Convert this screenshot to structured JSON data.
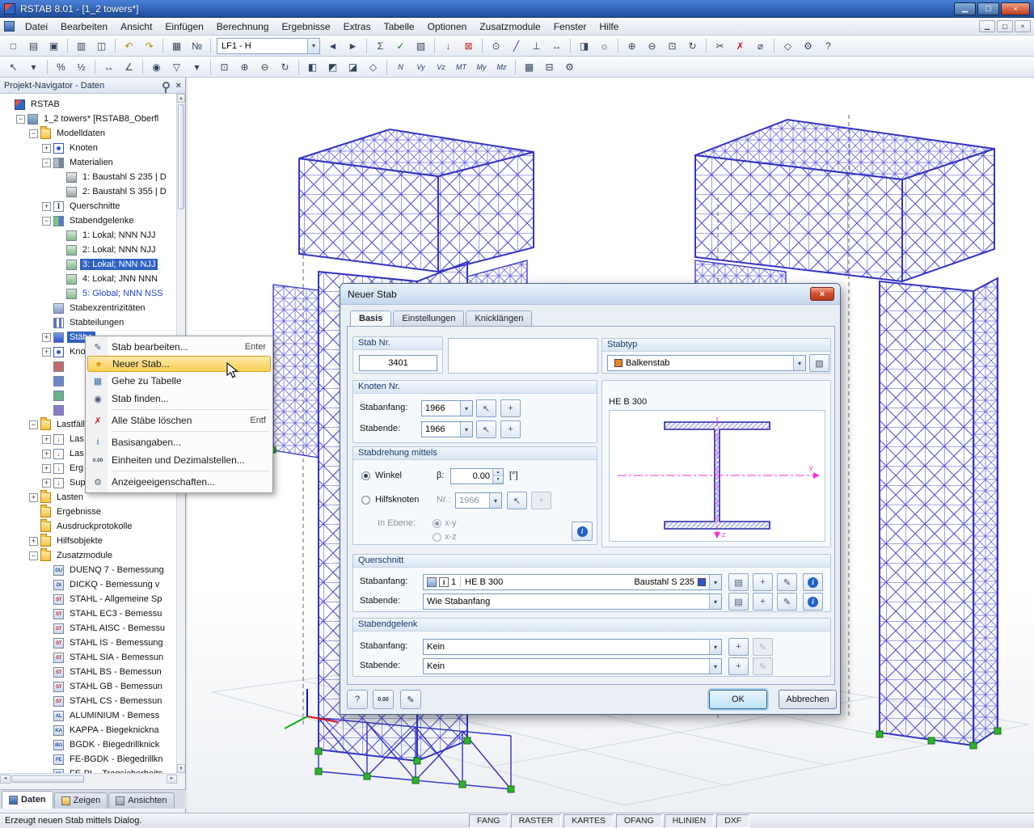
{
  "colors": {
    "titlebar1": "#4a7fd6",
    "titlebar2": "#1f4f9e",
    "selection": "#2f62c2",
    "menu-highlight1": "#fdeaa9",
    "menu-highlight2": "#f8cf57",
    "menu-highlight-border": "#d8a020",
    "model-blue": "#3c3ccd",
    "support-green": "#2db32d",
    "section-line": "#2626a8",
    "centerline-magenta": "#f230d8"
  },
  "titlebar": {
    "title": "RSTAB 8.01 - [1_2 towers*]",
    "minimize_glyph": "▁",
    "restore_glyph": "▢",
    "close_glyph": "×"
  },
  "menubar": {
    "items": [
      "Datei",
      "Bearbeiten",
      "Ansicht",
      "Einfügen",
      "Berechnung",
      "Ergebnisse",
      "Extras",
      "Tabelle",
      "Optionen",
      "Zusatzmodule",
      "Fenster",
      "Hilfe"
    ]
  },
  "toolbars": {
    "load_case": "LF1 - H",
    "row1": [
      {
        "g": "□",
        "n": "new-model"
      },
      {
        "g": "▤",
        "n": "open-model"
      },
      {
        "g": "▣",
        "n": "save-model"
      },
      "sep",
      {
        "g": "▥",
        "n": "print"
      },
      {
        "g": "◫",
        "n": "copy"
      },
      "sep",
      {
        "g": "↶",
        "n": "undo",
        "c": "#b08900"
      },
      {
        "g": "↷",
        "n": "redo",
        "c": "#b08900"
      },
      "sep",
      {
        "g": "▦",
        "n": "tables"
      },
      {
        "g": "№",
        "n": "numbering"
      },
      "sep",
      "combo",
      {
        "g": "◄",
        "n": "previous-load-case"
      },
      {
        "g": "►",
        "n": "next-load-case"
      },
      "sep",
      {
        "g": "Σ",
        "n": "calculate"
      },
      {
        "g": "✓",
        "n": "check-model",
        "c": "#118811"
      },
      {
        "g": "▧",
        "n": "show-results"
      },
      "sep",
      {
        "g": "↓",
        "n": "new-load",
        "c": "#bb2222"
      },
      {
        "g": "⊠",
        "n": "delete-load",
        "c": "#bb2222"
      },
      "sep",
      {
        "g": "⊙",
        "n": "new-node"
      },
      {
        "g": "╱",
        "n": "new-member",
        "c": "#2233bb"
      },
      {
        "g": "⊥",
        "n": "new-support"
      },
      {
        "g": "↔",
        "n": "new-dimension"
      },
      "sep",
      {
        "g": "◨",
        "n": "render-mode"
      },
      {
        "g": "☼",
        "n": "lighting"
      },
      "sep",
      {
        "g": "⊕",
        "n": "zoom-in"
      },
      {
        "g": "⊖",
        "n": "zoom-out"
      },
      {
        "g": "⊡",
        "n": "zoom-window"
      },
      {
        "g": "↻",
        "n": "rotate-view"
      },
      "sep",
      {
        "g": "✂",
        "n": "clip"
      },
      {
        "g": "✗",
        "n": "delete",
        "c": "#bb2222"
      },
      {
        "g": "⌀",
        "n": "measure"
      },
      "sep",
      {
        "g": "◇",
        "n": "isometric-view"
      },
      {
        "g": "⚙",
        "n": "options"
      },
      {
        "g": "?",
        "n": "help"
      }
    ],
    "row2": [
      {
        "g": "↖",
        "n": "select-pointer"
      },
      {
        "g": "▾",
        "n": "select-mode-dropdown"
      },
      "sep",
      {
        "g": "%",
        "n": "percentage"
      },
      {
        "g": "½",
        "n": "scale-half"
      },
      "sep",
      {
        "g": "↔",
        "n": "measure-length"
      },
      {
        "g": "∠",
        "n": "measure-angle"
      },
      "sep",
      {
        "g": "◉",
        "n": "visibility"
      },
      {
        "g": "▽",
        "n": "filter"
      },
      {
        "g": "▾",
        "n": "visibility-dropdown"
      },
      "sep",
      {
        "g": "⊡",
        "n": "zoom-region"
      },
      {
        "g": "⊕",
        "n": "view-zoom-in"
      },
      {
        "g": "⊖",
        "n": "view-zoom-out"
      },
      {
        "g": "↻",
        "n": "orbit"
      },
      "sep",
      {
        "g": "◧",
        "n": "view-yz"
      },
      {
        "g": "◩",
        "n": "view-xz"
      },
      {
        "g": "◪",
        "n": "view-xy"
      },
      {
        "g": "◇",
        "n": "view-iso"
      },
      "sep",
      {
        "s": "N",
        "n": "result-n"
      },
      {
        "s": "Vy",
        "n": "result-vy"
      },
      {
        "s": "Vz",
        "n": "result-vz"
      },
      {
        "s": "MT",
        "n": "result-mt"
      },
      {
        "s": "My",
        "n": "result-my"
      },
      {
        "s": "Mz",
        "n": "result-mz"
      },
      "sep",
      {
        "g": "▦",
        "n": "result-tables"
      },
      {
        "g": "⊟",
        "n": "panel-toggle"
      },
      {
        "g": "⚙",
        "n": "display-options"
      }
    ]
  },
  "navigator": {
    "title": "Projekt-Navigator - Daten",
    "tabs": [
      {
        "label": "Daten",
        "active": true
      },
      {
        "label": "Zeigen"
      },
      {
        "label": "Ansichten"
      }
    ],
    "tree": [
      {
        "l": "RSTAB",
        "v": 0,
        "i": "app"
      },
      {
        "l": "1_2 towers* [RSTAB8_Oberfl",
        "v": 1,
        "i": "building",
        "e": "-"
      },
      {
        "l": "Modelldaten",
        "v": 2,
        "i": "folder",
        "e": "-"
      },
      {
        "l": "Knoten",
        "v": 3,
        "i": "knoten",
        "e": "+"
      },
      {
        "l": "Materialien",
        "v": 3,
        "i": "material",
        "e": "-"
      },
      {
        "l": "1: Baustahl S 235 | D",
        "v": 4,
        "i": "matitem"
      },
      {
        "l": "2: Baustahl S 355 | D",
        "v": 4,
        "i": "matitem"
      },
      {
        "l": "Querschnitte",
        "v": 3,
        "i": "section",
        "e": "+"
      },
      {
        "l": "Stabendgelenke",
        "v": 3,
        "i": "hinge",
        "e": "-"
      },
      {
        "l": "1: Lokal; NNN NJJ",
        "v": 4,
        "i": "hingeitem"
      },
      {
        "l": "2: Lokal; NNN NJJ",
        "v": 4,
        "i": "hingeitem"
      },
      {
        "l": "3: Lokal; NNN NJJ",
        "v": 4,
        "i": "hingeitem",
        "sel": true
      },
      {
        "l": "4: Lokal; JNN NNN",
        "v": 4,
        "i": "hingeitem"
      },
      {
        "l": "5: Global; NNN NSS",
        "v": 4,
        "i": "hingeitem",
        "link": true
      },
      {
        "l": "Stabexzentrizitäten",
        "v": 3,
        "i": "exz"
      },
      {
        "l": "Stabteilungen",
        "v": 3,
        "i": "teilung"
      },
      {
        "l": "Stäbe",
        "v": 3,
        "i": "stab",
        "e": "+",
        "sel": true
      },
      {
        "l": "Kno",
        "v": 3,
        "i": "knoten",
        "e": "+"
      },
      {
        "l": "",
        "v": 3,
        "i": "stab",
        "tint": "#c86a6a"
      },
      {
        "l": "",
        "v": 3,
        "i": "stab",
        "tint": "#6a88c8"
      },
      {
        "l": "",
        "v": 3,
        "i": "stab",
        "tint": "#6ab08a"
      },
      {
        "l": "",
        "v": 3,
        "i": "stab",
        "tint": "#8a7ac8"
      },
      {
        "l": "Lastfäll",
        "v": 2,
        "i": "folder",
        "e": "-"
      },
      {
        "l": "Las",
        "v": 3,
        "i": "lf",
        "e": "+"
      },
      {
        "l": "Las",
        "v": 3,
        "i": "lf",
        "e": "+"
      },
      {
        "l": "Erg",
        "v": 3,
        "i": "lf",
        "e": "+"
      },
      {
        "l": "Sup",
        "v": 3,
        "i": "lf",
        "e": "+"
      },
      {
        "l": "Lasten",
        "v": 2,
        "i": "folder",
        "e": "+"
      },
      {
        "l": "Ergebnisse",
        "v": 2,
        "i": "folder"
      },
      {
        "l": "Ausdruckprotokolle",
        "v": 2,
        "i": "folder"
      },
      {
        "l": "Hilfsobjekte",
        "v": 2,
        "i": "folder",
        "e": "+"
      },
      {
        "l": "Zusatzmodule",
        "v": 2,
        "i": "folder",
        "e": "-"
      },
      {
        "l": "DUENQ 7 - Bemessung",
        "v": 3,
        "i": "mod"
      },
      {
        "l": "DICKQ - Bemessung v",
        "v": 3,
        "i": "mod"
      },
      {
        "l": "STAHL - Allgemeine Sp",
        "v": 3,
        "i": "mod"
      },
      {
        "l": "STAHL EC3 - Bemessu",
        "v": 3,
        "i": "mod"
      },
      {
        "l": "STAHL AISC - Bemessu",
        "v": 3,
        "i": "mod"
      },
      {
        "l": "STAHL IS - Bemessung",
        "v": 3,
        "i": "mod"
      },
      {
        "l": "STAHL SIA - Bemessun",
        "v": 3,
        "i": "mod"
      },
      {
        "l": "STAHL BS - Bemessun",
        "v": 3,
        "i": "mod"
      },
      {
        "l": "STAHL GB - Bemessun",
        "v": 3,
        "i": "mod"
      },
      {
        "l": "STAHL CS - Bemessun",
        "v": 3,
        "i": "mod"
      },
      {
        "l": "ALUMINIUM - Bemess",
        "v": 3,
        "i": "mod"
      },
      {
        "l": "KAPPA - Biegeknickna",
        "v": 3,
        "i": "mod"
      },
      {
        "l": "BGDK - Biegedrillknick",
        "v": 3,
        "i": "mod"
      },
      {
        "l": "FE-BGDK - Biegedrillkn",
        "v": 3,
        "i": "mod"
      },
      {
        "l": "FE-PL - Tragsicherheits",
        "v": 3,
        "i": "mod"
      }
    ]
  },
  "context_menu": {
    "items": [
      {
        "label": "Stab bearbeiten...",
        "shortcut": "Enter",
        "icon": "edit-member-icon",
        "g": "✎",
        "gc": "#44557a"
      },
      {
        "label": "Neuer Stab...",
        "icon": "new-member-icon",
        "g": "★",
        "gc": "#e09b00",
        "highlighted": true
      },
      {
        "label": "Gehe zu Tabelle",
        "icon": "table-icon",
        "g": "▦",
        "gc": "#3a6ea5"
      },
      {
        "label": "Stab finden...",
        "icon": "find-member-icon",
        "g": "◉",
        "gc": "#44557a",
        "separator_after": true
      },
      {
        "label": "Alle Stäbe löschen",
        "shortcut": "Entf",
        "icon": "delete-all-icon",
        "g": "✗",
        "gc": "#cc2222",
        "separator_after": true
      },
      {
        "label": "Basisangaben...",
        "icon": "base-data-icon",
        "g": "i",
        "gc": "#2266cc"
      },
      {
        "label": "Einheiten und Dezimalstellen...",
        "icon": "units-icon",
        "g": "0.00",
        "gc": "#334455",
        "small": true,
        "separator_after": true
      },
      {
        "label": "Anzeigeeigenschaften...",
        "icon": "display-properties-icon",
        "g": "⚙",
        "gc": "#556677"
      }
    ]
  },
  "dialog": {
    "title": "Neuer Stab",
    "tabs": [
      "Basis",
      "Einstellungen",
      "Knicklängen"
    ],
    "stab_nr": {
      "caption": "Stab Nr.",
      "value": "3401"
    },
    "stabtyp": {
      "caption": "Stabtyp",
      "value": "Balkenstab"
    },
    "knoten": {
      "caption": "Knoten Nr.",
      "anfang_label": "Stabanfang:",
      "anfang": "1966",
      "ende_label": "Stabende:",
      "ende": "1966"
    },
    "drehung": {
      "caption": "Stabdrehung mittels",
      "winkel": "Winkel",
      "beta": "β:",
      "beta_value": "0.00",
      "unit": "[°]",
      "hilfsknoten": "Hilfsknoten",
      "nr": "Nr.:",
      "nr_value": "1966",
      "ebene": "In Ebene:",
      "xy": "x-y",
      "xz": "x-z"
    },
    "section": {
      "name": "HE B 300",
      "axis_y": "y",
      "axis_z": "z"
    },
    "querschnitt": {
      "caption": "Querschnitt",
      "anfang_label": "Stabanfang:",
      "nr": "1",
      "name": "HE B 300",
      "material": "Baustahl S 235",
      "ende_label": "Stabende:",
      "ende": "Wie Stabanfang"
    },
    "gelenk": {
      "caption": "Stabendgelenk",
      "anfang_label": "Stabanfang:",
      "anfang": "Kein",
      "ende_label": "Stabende:",
      "ende": "Kein"
    },
    "footer": {
      "help": "?",
      "units": "0.00",
      "ok": "OK",
      "cancel": "Abbrechen"
    }
  },
  "statusbar": {
    "message": "Erzeugt neuen Stab mittels Dialog.",
    "toggles": [
      "FANG",
      "RASTER",
      "KARTES",
      "OFANG",
      "HLINIEN",
      "DXF"
    ]
  }
}
